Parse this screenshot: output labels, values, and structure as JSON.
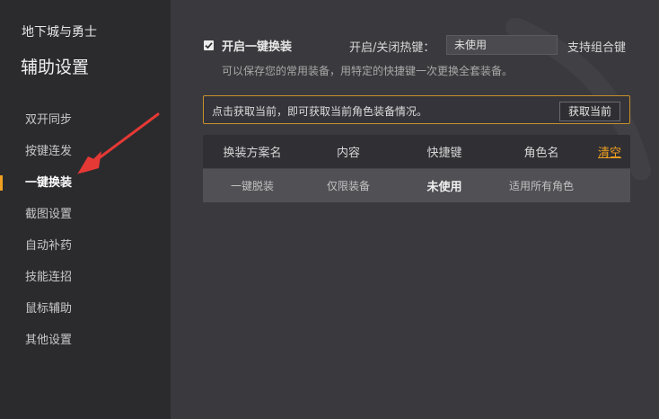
{
  "sidebar": {
    "game_name": "地下城与勇士",
    "title": "辅助设置",
    "items": [
      {
        "label": "双开同步"
      },
      {
        "label": "按键连发"
      },
      {
        "label": "一键换装"
      },
      {
        "label": "截图设置"
      },
      {
        "label": "自动补药"
      },
      {
        "label": "技能连招"
      },
      {
        "label": "鼠标辅助"
      },
      {
        "label": "其他设置"
      }
    ],
    "active_index": 2
  },
  "settings": {
    "enable_checked": true,
    "enable_label": "开启一键换装",
    "hotkey_label": "开启/关闭热键：",
    "hotkey_value": "未使用",
    "combo_hint": "支持组合键",
    "description": "可以保存您的常用装备，用特定的快捷键一次更换全套装备。"
  },
  "fetch": {
    "text": "点击获取当前，即可获取当前角色装备情况。",
    "button_label": "获取当前"
  },
  "table": {
    "headers": {
      "scheme": "换装方案名",
      "content": "内容",
      "hotkey": "快捷键",
      "role": "角色名",
      "clear": "清空"
    },
    "rows": [
      {
        "scheme": "一键脱装",
        "content": "仅限装备",
        "hotkey": "未使用",
        "role": "适用所有角色"
      }
    ]
  },
  "colors": {
    "accent": "#f0a020",
    "sidebar_bg": "#2b2b2e",
    "main_bg": "#3a3a3e",
    "annotation_arrow": "#e53935"
  }
}
